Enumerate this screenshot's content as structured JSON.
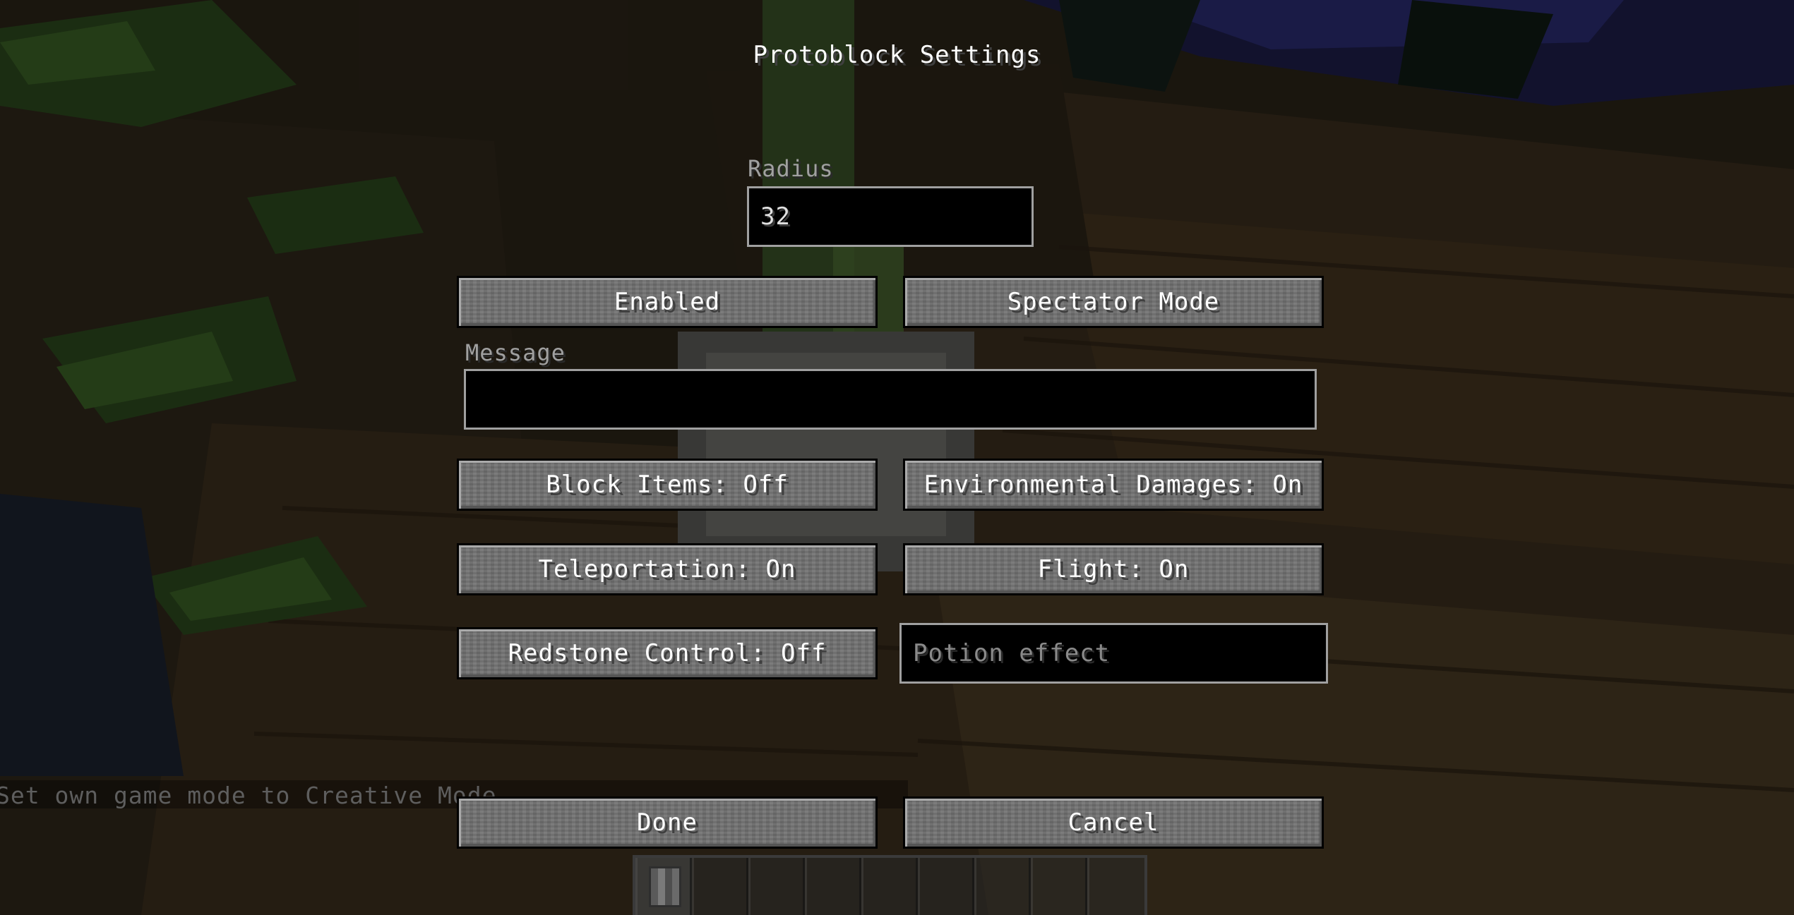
{
  "screen": {
    "title": "Protoblock Settings"
  },
  "radius": {
    "label": "Radius",
    "value": "32"
  },
  "buttons": {
    "enabled": "Enabled",
    "spectator_mode": "Spectator Mode",
    "block_items": "Block Items: Off",
    "environmental_damages": "Environmental Damages: On",
    "teleportation": "Teleportation: On",
    "flight": "Flight: On",
    "redstone_control": "Redstone Control: Off",
    "done": "Done",
    "cancel": "Cancel"
  },
  "message": {
    "label": "Message",
    "value": ""
  },
  "potion_effect": {
    "placeholder": "Potion effect",
    "value": ""
  },
  "chat": {
    "line": "Set own game mode to Creative Mode"
  },
  "hotbar": {
    "slot_count": 9,
    "selected_slot": 1,
    "slot_1_item": "stone-block-icon"
  },
  "colors": {
    "button_face": "#6f6f6f",
    "button_text": "#ffffff",
    "field_bg": "#000000",
    "field_border": "#a0a0a0",
    "label_text": "#a0a0a0"
  }
}
